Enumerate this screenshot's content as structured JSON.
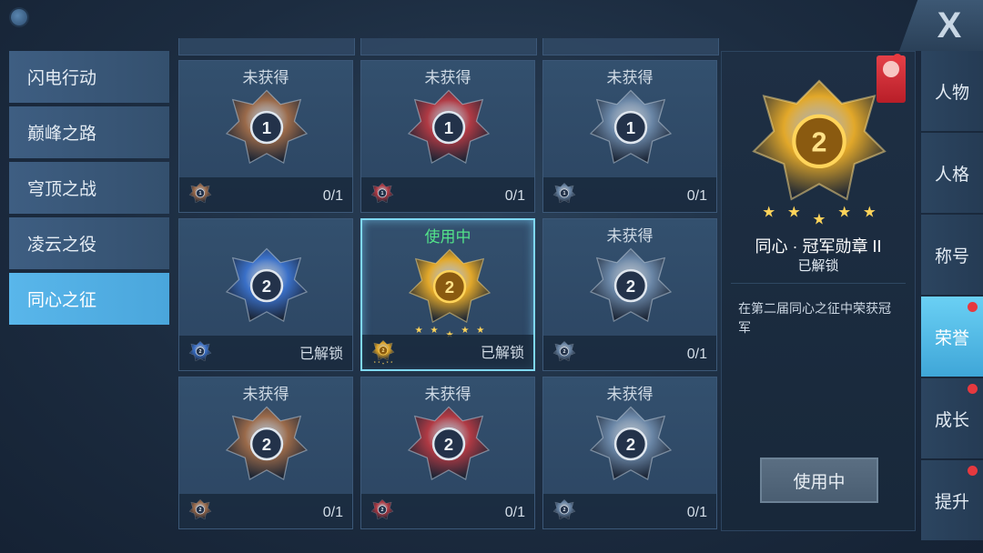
{
  "categories": [
    {
      "label": "闪电行动"
    },
    {
      "label": "巅峰之路"
    },
    {
      "label": "穹顶之战"
    },
    {
      "label": "凌云之役"
    },
    {
      "label": "同心之征"
    }
  ],
  "active_category": "同心之征",
  "medals": [
    {
      "status": "未获得",
      "progress": "0/1",
      "tier": "1",
      "material": "bronze"
    },
    {
      "status": "未获得",
      "progress": "0/1",
      "tier": "1",
      "material": "red"
    },
    {
      "status": "未获得",
      "progress": "0/1",
      "tier": "1",
      "material": "steel"
    },
    {
      "status": "",
      "progress": "已解锁",
      "tier": "2",
      "material": "blue"
    },
    {
      "status": "使用中",
      "progress": "已解锁",
      "tier": "2",
      "material": "gold",
      "selected": true
    },
    {
      "status": "未获得",
      "progress": "0/1",
      "tier": "2",
      "material": "steel"
    },
    {
      "status": "未获得",
      "progress": "0/1",
      "tier": "2",
      "material": "bronze"
    },
    {
      "status": "未获得",
      "progress": "0/1",
      "tier": "2",
      "material": "red"
    },
    {
      "status": "未获得",
      "progress": "0/1",
      "tier": "2",
      "material": "steel"
    }
  ],
  "detail": {
    "title": "同心 · 冠军勋章 II",
    "status": "已解锁",
    "description": "在第二届同心之征中荣获冠军",
    "button": "使用中",
    "tier": "2"
  },
  "tabs": [
    {
      "label": "人物",
      "dot": false
    },
    {
      "label": "人格",
      "dot": false
    },
    {
      "label": "称号",
      "dot": false
    },
    {
      "label": "荣誉",
      "dot": true,
      "active": true
    },
    {
      "label": "成长",
      "dot": true
    },
    {
      "label": "提升",
      "dot": true
    }
  ],
  "close_label": "X",
  "colors": {
    "bronze": "#9a6a4a",
    "red": "#b03a44",
    "steel": "#6a86a6",
    "blue": "#3a70c8",
    "gold": "#e2a82a",
    "in_use_text": "#53e38a",
    "active_tab": "#4fb4e2"
  }
}
